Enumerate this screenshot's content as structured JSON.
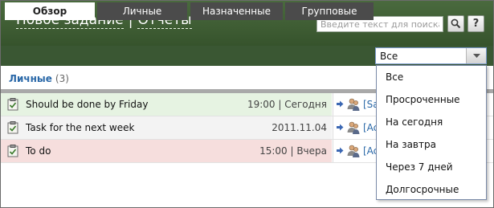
{
  "header": {
    "new_task": "Новое задание",
    "separator": "|",
    "reports": "Отчеты",
    "search_placeholder": "Введите текст для поиска",
    "help_label": "?"
  },
  "tabs": [
    {
      "label": "Обзор",
      "active": true
    },
    {
      "label": "Личные",
      "active": false
    },
    {
      "label": "Назначенные",
      "active": false
    },
    {
      "label": "Групповые",
      "active": false
    }
  ],
  "filter": {
    "selected": "Все",
    "options": [
      "Все",
      "Просроченные",
      "На сегодня",
      "На завтра",
      "Через 7 дней",
      "Долгосрочные"
    ]
  },
  "section": {
    "title": "Личные",
    "count": "(3)"
  },
  "tasks": [
    {
      "title": "Should be done by Friday",
      "date": "19:00 | Сегодня",
      "assignee": "[Sa",
      "status_color": "#e6f3e2"
    },
    {
      "title": "Task for the next week",
      "date": "2011.11.04",
      "assignee": "[Ac",
      "status_color": "#f3f3f3"
    },
    {
      "title": "To do",
      "date": "15:00 | Вчера",
      "assignee": "[Ac",
      "status_color": "#f6dedd"
    }
  ],
  "icons": {
    "search": "magnifier-icon",
    "help": "question-icon",
    "task": "clipboard-icon",
    "arrow": "arrow-right-icon",
    "users": "users-icon",
    "dropdown": "chevron-down-icon"
  },
  "colors": {
    "header_bg": "#3f5f35",
    "link_blue": "#2a68a8",
    "tab_dark": "#4b4b4b"
  }
}
